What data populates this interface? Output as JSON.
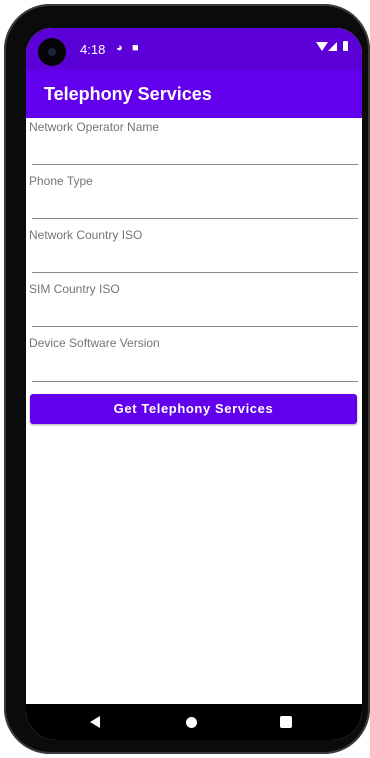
{
  "status_bar": {
    "time": "4:18",
    "icons": [
      "notification-icon",
      "sim-card-icon",
      "wifi-icon",
      "signal-icon",
      "battery-icon"
    ]
  },
  "app_bar": {
    "title": "Telephony Services",
    "color": "#6200ee"
  },
  "form": {
    "fields": [
      {
        "label": "Network Operator Name",
        "value": ""
      },
      {
        "label": "Phone Type",
        "value": ""
      },
      {
        "label": "Network Country ISO",
        "value": ""
      },
      {
        "label": "SIM Country ISO",
        "value": ""
      },
      {
        "label": "Device Software Version",
        "value": ""
      }
    ]
  },
  "button": {
    "label": "Get Telephony Services",
    "color": "#6200ee"
  },
  "nav_bar": {
    "icons": [
      "back-icon",
      "home-icon",
      "recents-icon"
    ]
  }
}
